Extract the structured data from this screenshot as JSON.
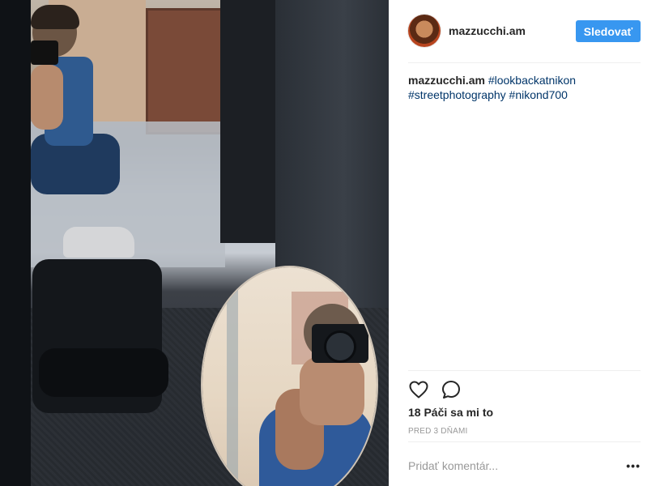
{
  "post": {
    "username": "mazzucchi.am",
    "follow_label": "Sledovať",
    "caption": {
      "user": "mazzucchi.am",
      "hashtags": [
        "#lookbackatnikon",
        "#streetphotography",
        "#nikond700"
      ]
    },
    "likes_text": "18 Páči sa mi to",
    "timestamp": "PRED 3 DŇAMI",
    "comment_placeholder": "Pridať komentár...",
    "more_label": "•••"
  },
  "icons": {
    "like": "heart-icon",
    "comment": "comment-icon",
    "more": "more-options-icon"
  },
  "colors": {
    "follow_button": "#3897f0",
    "hashtag": "#003569",
    "muted": "#999999"
  }
}
